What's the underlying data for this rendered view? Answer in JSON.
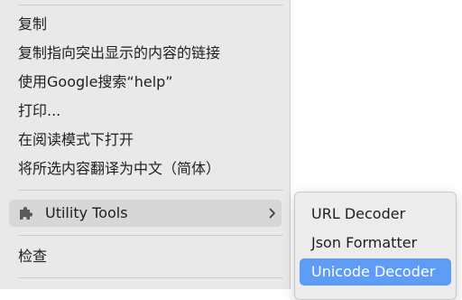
{
  "context_menu": {
    "items": [
      {
        "label": "复制"
      },
      {
        "label": "复制指向突出显示的内容的链接"
      },
      {
        "label": "使用Google搜索“help”"
      },
      {
        "label": "打印..."
      },
      {
        "label": "在阅读模式下打开"
      },
      {
        "label": "将所选内容翻译为中文（简体）"
      }
    ],
    "extension": {
      "label": "Utility Tools",
      "icon": "puzzle-piece-icon"
    },
    "inspect": {
      "label": "检查"
    }
  },
  "submenu": {
    "items": [
      {
        "label": "URL Decoder"
      },
      {
        "label": "Json Formatter"
      },
      {
        "label": "Unicode Decoder",
        "active": true
      }
    ]
  },
  "colors": {
    "menu_background": "#e9e9e9",
    "hover_background": "#d7d7d7",
    "selected": "#5e9cf5"
  }
}
